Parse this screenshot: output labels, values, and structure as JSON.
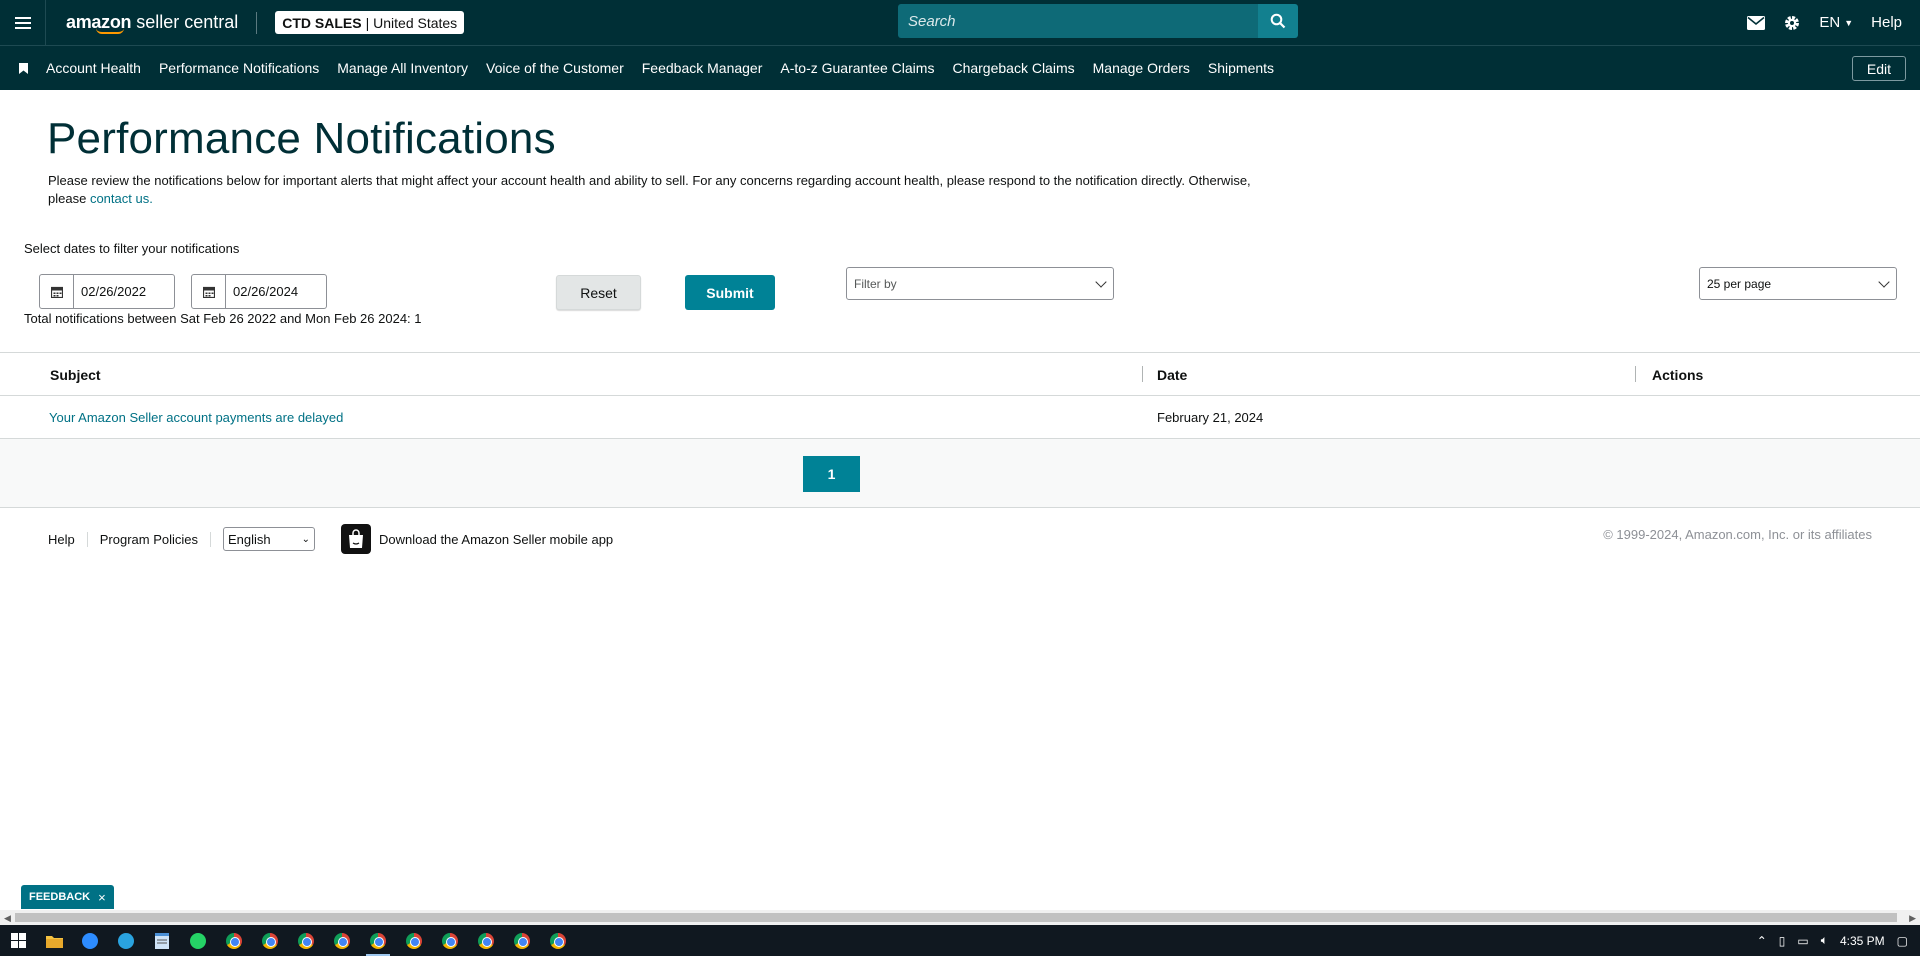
{
  "header": {
    "logo_part1": "amazon",
    "logo_part2": " seller central",
    "account_name": "CTD SALES",
    "account_region": "| United States",
    "search_placeholder": "Search",
    "language": "EN",
    "help_label": "Help"
  },
  "nav": {
    "items": [
      "Account Health",
      "Performance Notifications",
      "Manage All Inventory",
      "Voice of the Customer",
      "Feedback Manager",
      "A-to-z Guarantee Claims",
      "Chargeback Claims",
      "Manage Orders",
      "Shipments"
    ],
    "edit_label": "Edit"
  },
  "page": {
    "title": "Performance Notifications",
    "description": "Please review the notifications below for important alerts that might affect your account health and ability to sell. For any concerns regarding account health, please respond to the notification directly. Otherwise, please",
    "contact_link": "contact us.",
    "filter_label": "Select dates to filter your notifications",
    "start_date": "02/26/2022",
    "end_date": "02/26/2024",
    "reset_label": "Reset",
    "submit_label": "Submit",
    "filter_by_placeholder": "Filter by",
    "per_page": "25 per page",
    "total_text": "Total notifications between Sat Feb 26 2022 and Mon Feb 26 2024: 1"
  },
  "table": {
    "columns": [
      "Subject",
      "Date",
      "Actions"
    ],
    "rows": [
      {
        "subject": "Your Amazon Seller account payments are delayed",
        "date": "February 21, 2024",
        "actions": ""
      }
    ],
    "current_page": "1"
  },
  "footer": {
    "help": "Help",
    "program_policies": "Program Policies",
    "language": "English",
    "download_app": "Download the Amazon Seller mobile app",
    "copyright": "© 1999-2024, Amazon.com, Inc. or its affiliates"
  },
  "feedback": {
    "label": "FEEDBACK",
    "close": "×"
  },
  "taskbar": {
    "time": "4:35 PM"
  },
  "colors": {
    "header_bg": "#002f36",
    "accent": "#008296",
    "link": "#007185"
  }
}
